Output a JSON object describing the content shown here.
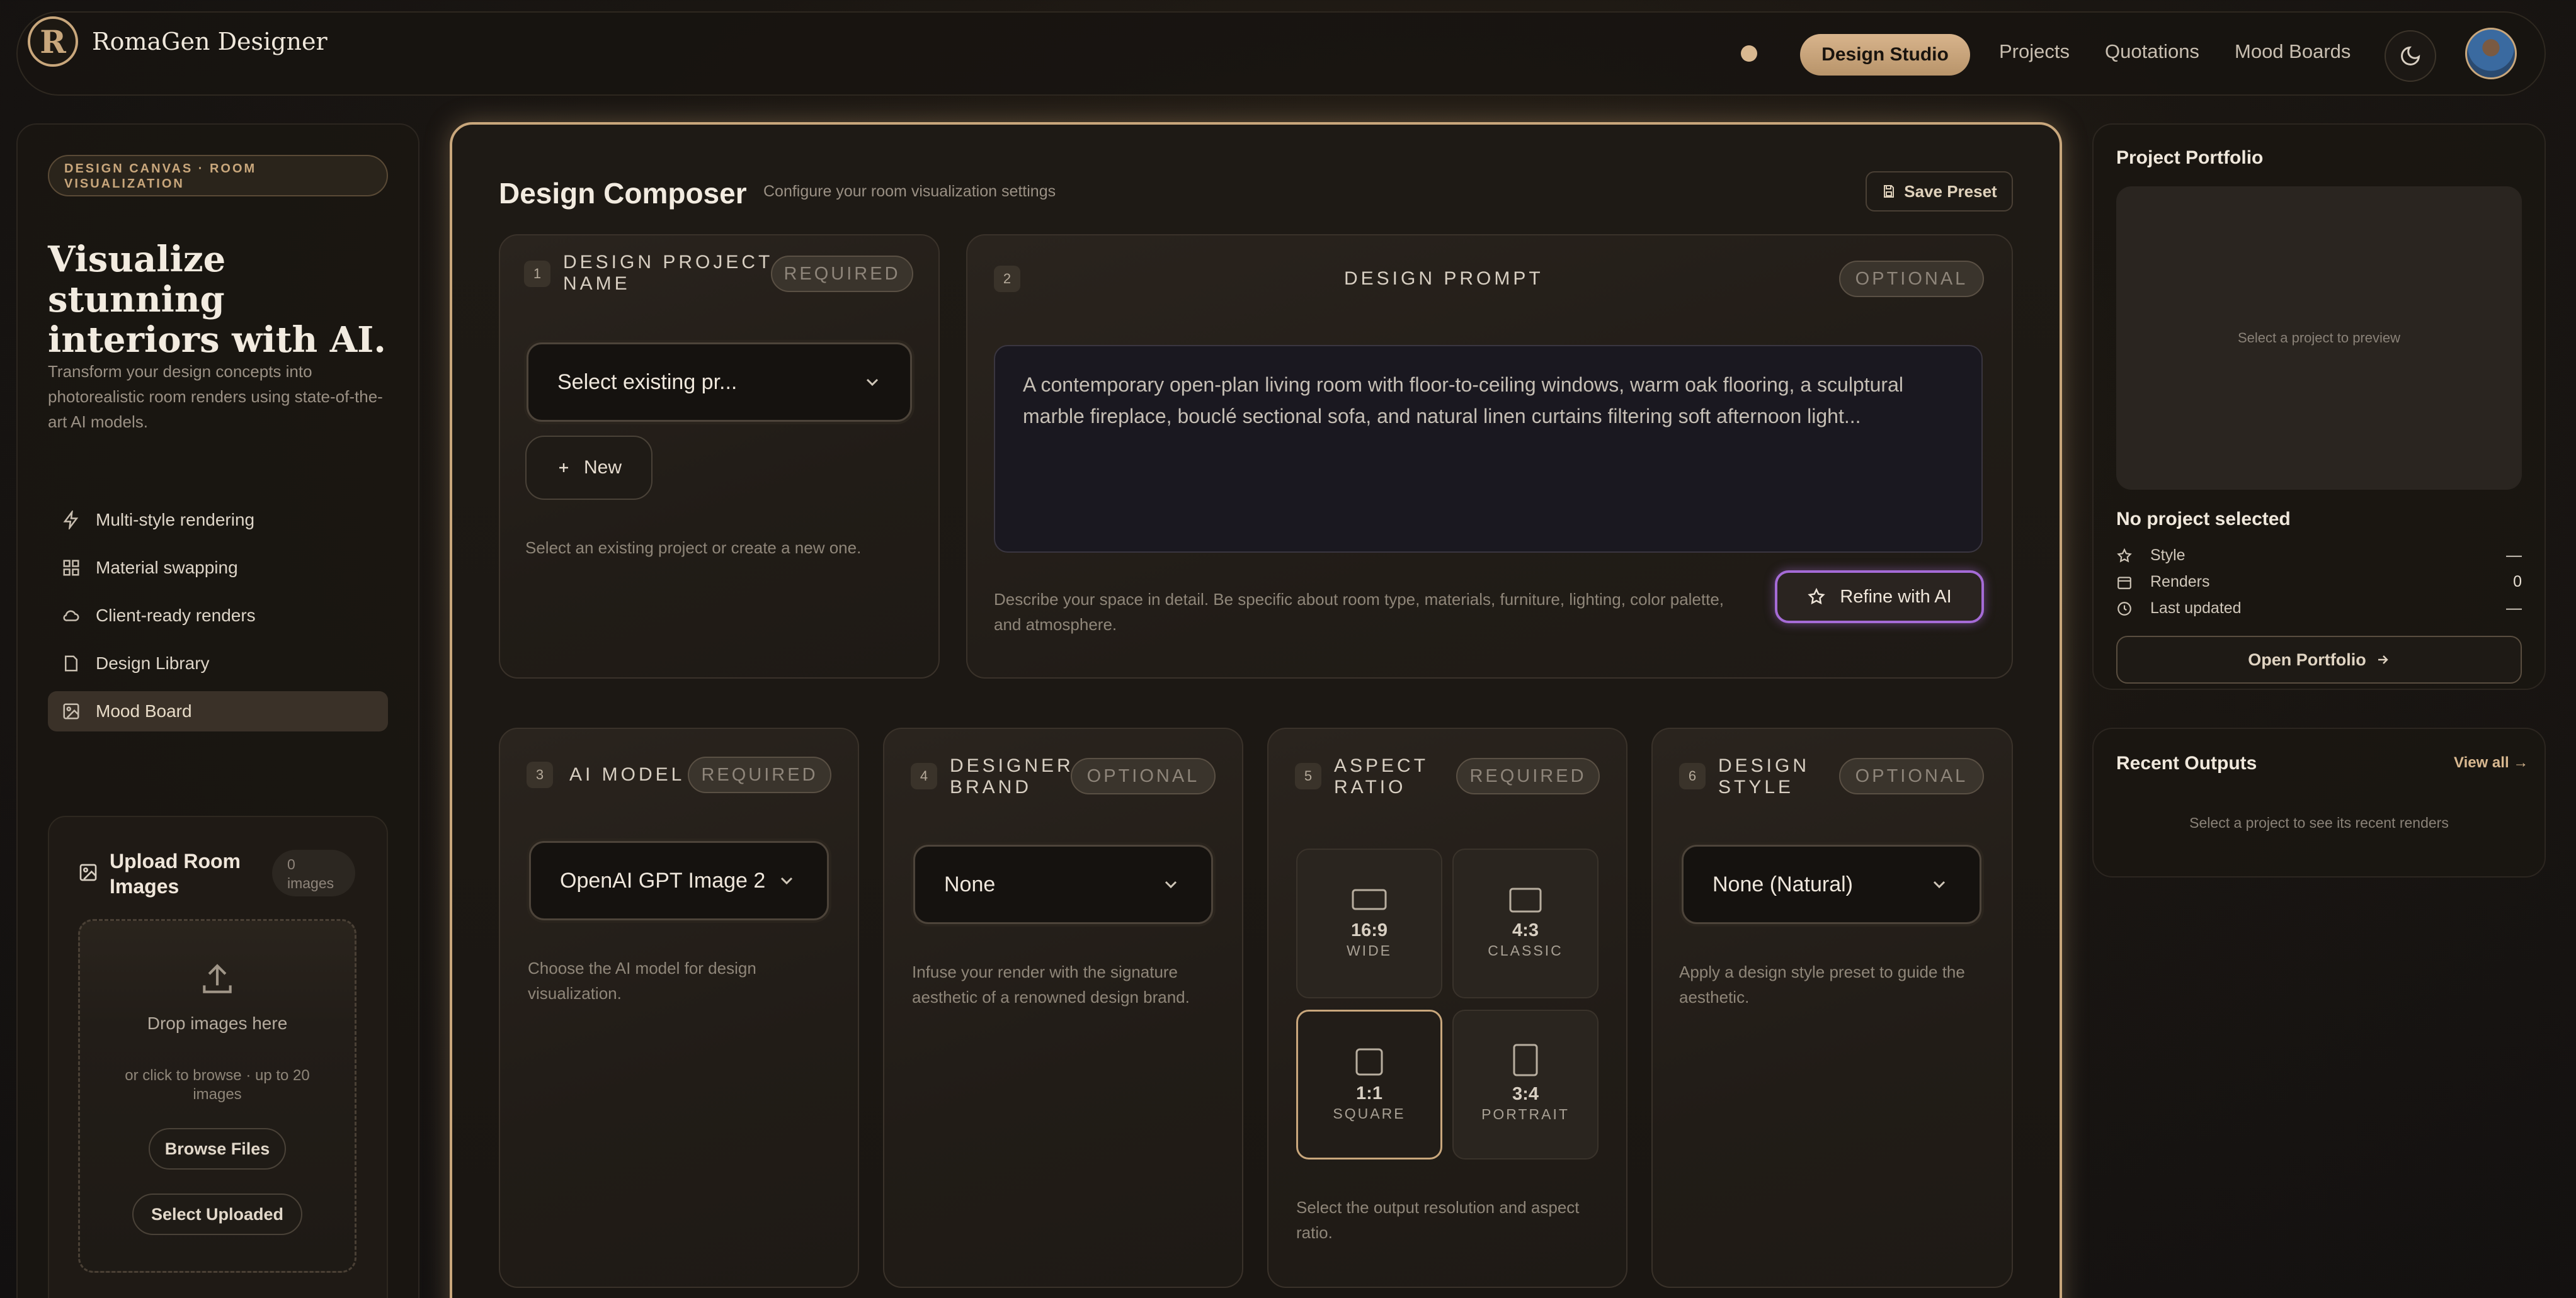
{
  "header": {
    "brand_name": "RomaGen Designer",
    "logo_letter": "R",
    "nav": {
      "active": "Design Studio",
      "projects": "Projects",
      "quotations": "Quotations",
      "mood_boards": "Mood Boards"
    }
  },
  "sidebar": {
    "tag": "DESIGN CANVAS · ROOM VISUALIZATION",
    "hero_line1": "Visualize stunning",
    "hero_line2": "interiors with AI.",
    "description": "Transform your design concepts into photorealistic room renders using state-of-the-art AI models.",
    "features": [
      {
        "label": "Multi-style rendering",
        "icon": "lightning-icon"
      },
      {
        "label": "Material swapping",
        "icon": "grid-icon"
      },
      {
        "label": "Client-ready renders",
        "icon": "cloud-icon"
      },
      {
        "label": "Design Library",
        "icon": "document-icon"
      },
      {
        "label": "Mood Board",
        "icon": "image-icon",
        "active": true
      }
    ],
    "upload": {
      "title": "Upload Room Images",
      "count": "0",
      "count_label": "images",
      "drop_text": "Drop images here",
      "browse_hint": "or click to browse · up to 20 images",
      "browse_button": "Browse Files",
      "select_button": "Select Uploaded"
    }
  },
  "composer": {
    "title": "Design Composer",
    "subtitle": "Configure your room visualization settings",
    "save_preset": "Save Preset",
    "project": {
      "number": "1",
      "label_line1": "DESIGN PROJECT",
      "label_line2": "NAME",
      "badge": "REQUIRED",
      "select_value": "Select existing pr...",
      "new_button": "New",
      "hint": "Select an existing project or create a new one."
    },
    "prompt": {
      "number": "2",
      "label": "DESIGN PROMPT",
      "badge": "OPTIONAL",
      "value": "A contemporary open-plan living room with floor-to-ceiling windows, warm oak flooring, a sculptural marble fireplace, bouclé sectional sofa, and natural linen curtains filtering soft afternoon light...",
      "hint": "Describe your space in detail. Be specific about room type, materials, furniture, lighting, color palette, and atmosphere.",
      "refine_button": "Refine with AI"
    },
    "model": {
      "number": "3",
      "label": "AI MODEL",
      "badge": "REQUIRED",
      "select_value": "OpenAI GPT Image 2",
      "hint": "Choose the AI model for design visualization."
    },
    "brand": {
      "number": "4",
      "label_line1": "DESIGNER",
      "label_line2": "BRAND",
      "badge": "OPTIONAL",
      "select_value": "None",
      "hint": "Infuse your render with the signature aesthetic of a renowned design brand."
    },
    "aspect": {
      "number": "5",
      "label_line1": "ASPECT",
      "label_line2": "RATIO",
      "badge": "REQUIRED",
      "options": [
        {
          "ratio": "16:9",
          "name": "WIDE"
        },
        {
          "ratio": "4:3",
          "name": "CLASSIC"
        },
        {
          "ratio": "1:1",
          "name": "SQUARE",
          "selected": true
        },
        {
          "ratio": "3:4",
          "name": "PORTRAIT"
        }
      ],
      "hint": "Select the output resolution and aspect ratio."
    },
    "style": {
      "number": "6",
      "label_line1": "DESIGN",
      "label_line2": "STYLE",
      "badge": "OPTIONAL",
      "select_value": "None (Natural)",
      "hint": "Apply a design style preset to guide the aesthetic."
    }
  },
  "portfolio": {
    "title": "Project Portfolio",
    "preview_placeholder": "Select a project to preview",
    "status": "No project selected",
    "rows": [
      {
        "label": "Style",
        "value": "—"
      },
      {
        "label": "Renders",
        "value": "0"
      },
      {
        "label": "Last updated",
        "value": "—"
      }
    ],
    "open_button": "Open Portfolio"
  },
  "recent": {
    "title": "Recent Outputs",
    "view_all": "View all",
    "empty": "Select a project to see its recent renders"
  },
  "colors": {
    "accent": "#c9a77c",
    "refine_border": "#a56bd6",
    "background": "#1a1612"
  }
}
